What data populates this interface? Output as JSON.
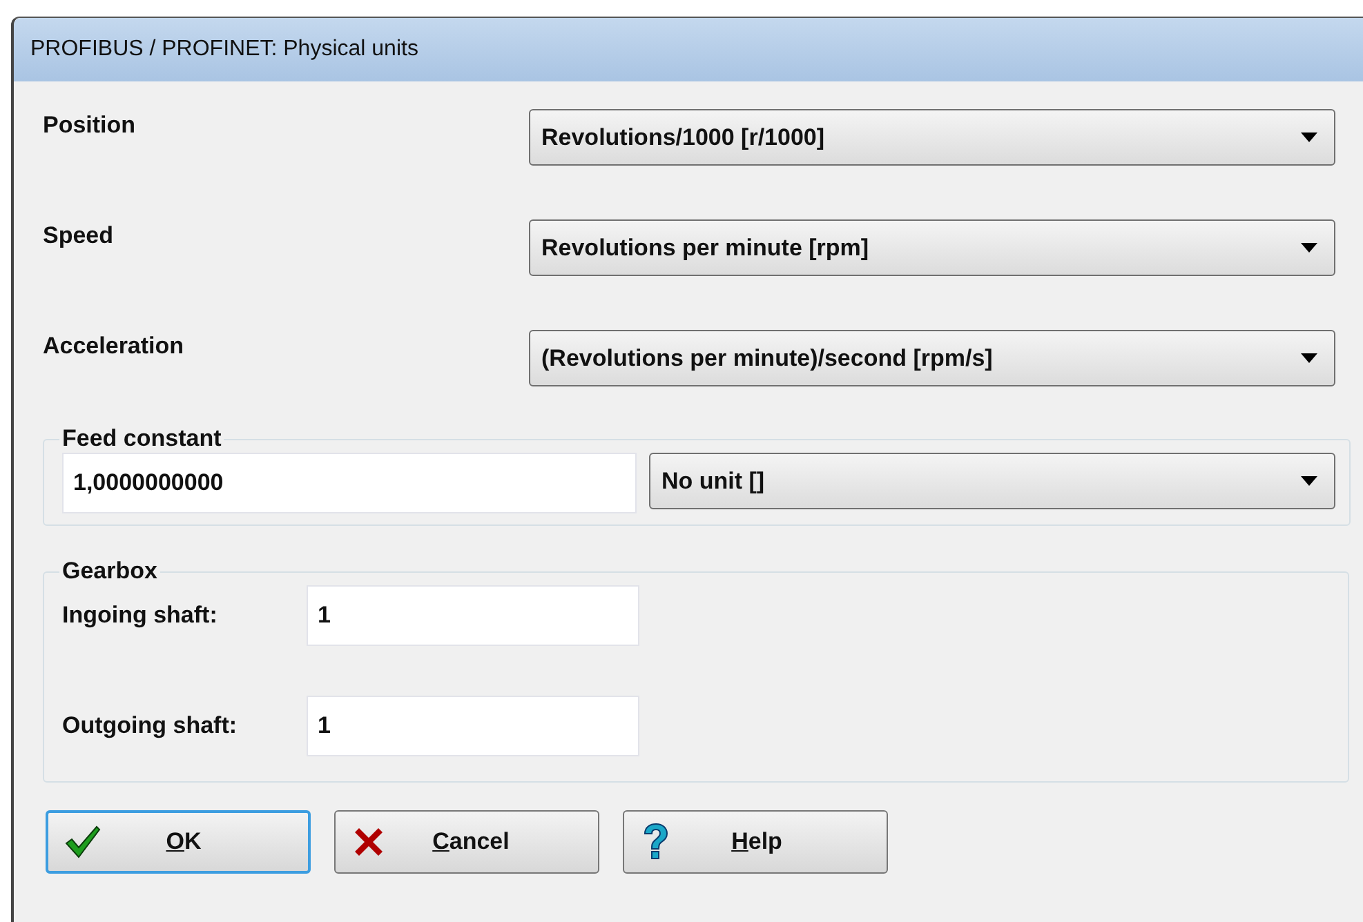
{
  "window": {
    "title": "PROFIBUS / PROFINET: Physical units"
  },
  "units": [
    {
      "label": "Position",
      "value": "Revolutions/1000 [r/1000]"
    },
    {
      "label": "Speed",
      "value": "Revolutions per minute [rpm]"
    },
    {
      "label": "Acceleration",
      "value": "(Revolutions per minute)/second [rpm/s]"
    }
  ],
  "feed_constant": {
    "title": "Feed constant",
    "value": "1,0000000000",
    "unit": "No unit []"
  },
  "gearbox": {
    "title": "Gearbox",
    "fields": [
      {
        "label": "Ingoing shaft:",
        "value": "1"
      },
      {
        "label": "Outgoing shaft:",
        "value": "1"
      }
    ]
  },
  "buttons": [
    {
      "kind": "ok",
      "mnemonic": "O",
      "rest": "K",
      "focused": true
    },
    {
      "kind": "cancel",
      "mnemonic": "C",
      "rest": "ancel",
      "focused": false
    },
    {
      "kind": "help",
      "mnemonic": "H",
      "rest": "elp",
      "focused": false
    }
  ]
}
